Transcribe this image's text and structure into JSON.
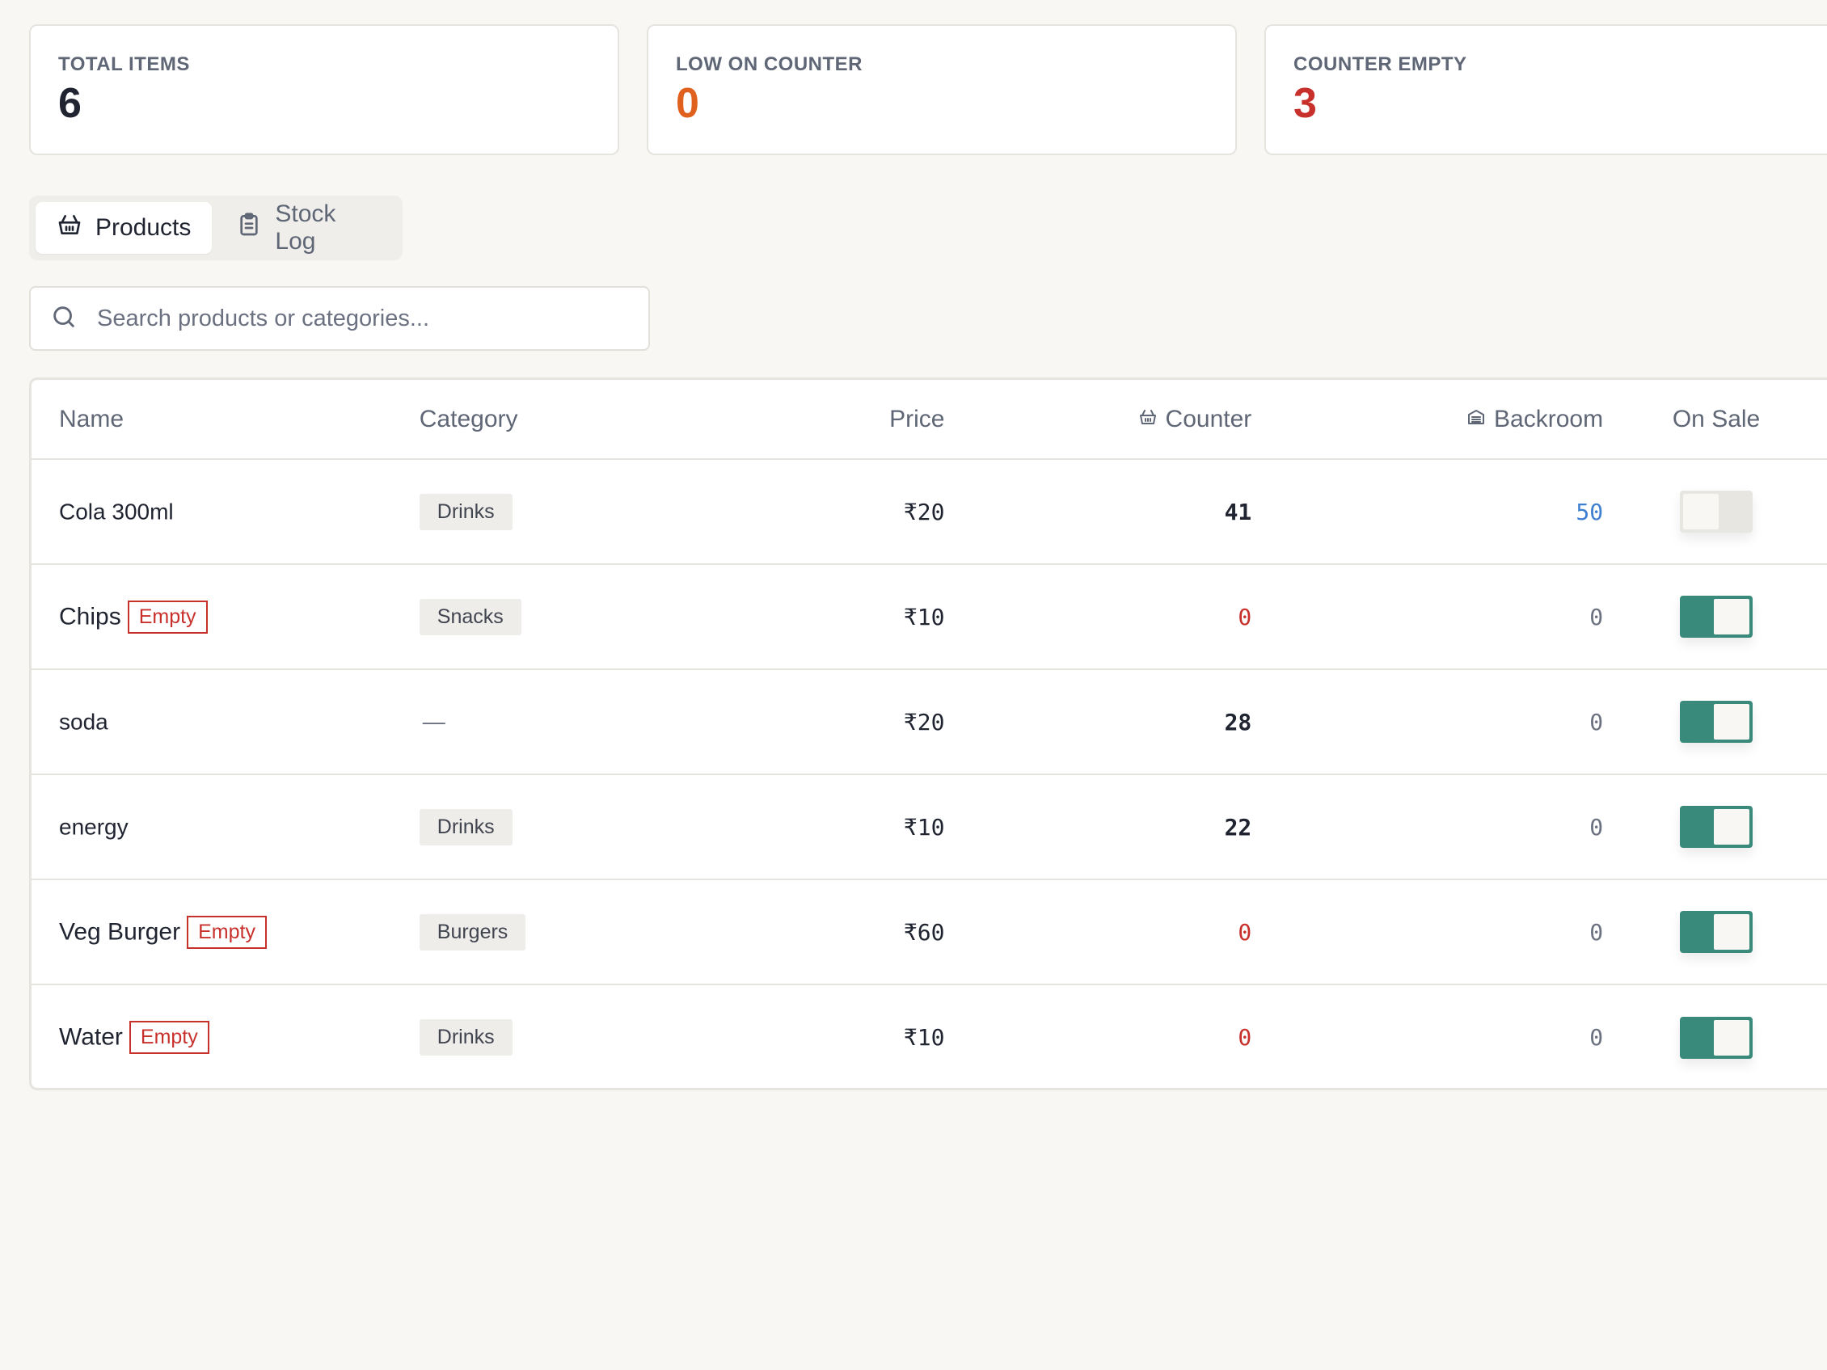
{
  "stats": {
    "total_label": "TOTAL ITEMS",
    "total_value": "6",
    "low_label": "LOW ON COUNTER",
    "low_value": "0",
    "empty_label": "COUNTER EMPTY",
    "empty_value": "3"
  },
  "colors": {
    "low_value": "#e0601e",
    "empty_value": "#c8302c",
    "toggle_on": "#3a8a7c"
  },
  "tabs": {
    "products_label": "Products",
    "stocklog_label": "Stock Log",
    "active": "Products"
  },
  "search": {
    "placeholder": "Search products or categories..."
  },
  "table": {
    "headers": {
      "name": "Name",
      "category": "Category",
      "price": "Price",
      "counter": "Counter",
      "backroom": "Backroom",
      "on_sale": "On Sale"
    },
    "empty_badge": "Empty",
    "rows": [
      {
        "name": "Cola 300ml",
        "empty": false,
        "category": "Drinks",
        "price": "₹20",
        "counter": "41",
        "backroom": "50",
        "on_sale": false
      },
      {
        "name": "Chips",
        "empty": true,
        "category": "Snacks",
        "price": "₹10",
        "counter": "0",
        "backroom": "0",
        "on_sale": true
      },
      {
        "name": "soda",
        "empty": false,
        "category": "—",
        "price": "₹20",
        "counter": "28",
        "backroom": "0",
        "on_sale": true
      },
      {
        "name": "energy",
        "empty": false,
        "category": "Drinks",
        "price": "₹10",
        "counter": "22",
        "backroom": "0",
        "on_sale": true
      },
      {
        "name": "Veg Burger",
        "empty": true,
        "category": "Burgers",
        "price": "₹60",
        "counter": "0",
        "backroom": "0",
        "on_sale": true
      },
      {
        "name": "Water",
        "empty": true,
        "category": "Drinks",
        "price": "₹10",
        "counter": "0",
        "backroom": "0",
        "on_sale": true
      }
    ]
  }
}
